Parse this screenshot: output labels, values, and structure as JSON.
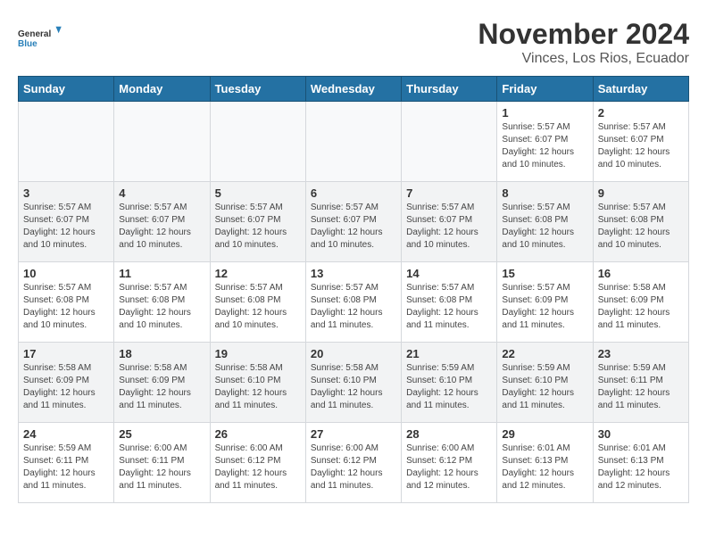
{
  "logo": {
    "general": "General",
    "blue": "Blue"
  },
  "title": "November 2024",
  "subtitle": "Vinces, Los Rios, Ecuador",
  "days_of_week": [
    "Sunday",
    "Monday",
    "Tuesday",
    "Wednesday",
    "Thursday",
    "Friday",
    "Saturday"
  ],
  "weeks": [
    [
      {
        "day": "",
        "info": ""
      },
      {
        "day": "",
        "info": ""
      },
      {
        "day": "",
        "info": ""
      },
      {
        "day": "",
        "info": ""
      },
      {
        "day": "",
        "info": ""
      },
      {
        "day": "1",
        "info": "Sunrise: 5:57 AM\nSunset: 6:07 PM\nDaylight: 12 hours and 10 minutes."
      },
      {
        "day": "2",
        "info": "Sunrise: 5:57 AM\nSunset: 6:07 PM\nDaylight: 12 hours and 10 minutes."
      }
    ],
    [
      {
        "day": "3",
        "info": "Sunrise: 5:57 AM\nSunset: 6:07 PM\nDaylight: 12 hours and 10 minutes."
      },
      {
        "day": "4",
        "info": "Sunrise: 5:57 AM\nSunset: 6:07 PM\nDaylight: 12 hours and 10 minutes."
      },
      {
        "day": "5",
        "info": "Sunrise: 5:57 AM\nSunset: 6:07 PM\nDaylight: 12 hours and 10 minutes."
      },
      {
        "day": "6",
        "info": "Sunrise: 5:57 AM\nSunset: 6:07 PM\nDaylight: 12 hours and 10 minutes."
      },
      {
        "day": "7",
        "info": "Sunrise: 5:57 AM\nSunset: 6:07 PM\nDaylight: 12 hours and 10 minutes."
      },
      {
        "day": "8",
        "info": "Sunrise: 5:57 AM\nSunset: 6:08 PM\nDaylight: 12 hours and 10 minutes."
      },
      {
        "day": "9",
        "info": "Sunrise: 5:57 AM\nSunset: 6:08 PM\nDaylight: 12 hours and 10 minutes."
      }
    ],
    [
      {
        "day": "10",
        "info": "Sunrise: 5:57 AM\nSunset: 6:08 PM\nDaylight: 12 hours and 10 minutes."
      },
      {
        "day": "11",
        "info": "Sunrise: 5:57 AM\nSunset: 6:08 PM\nDaylight: 12 hours and 10 minutes."
      },
      {
        "day": "12",
        "info": "Sunrise: 5:57 AM\nSunset: 6:08 PM\nDaylight: 12 hours and 10 minutes."
      },
      {
        "day": "13",
        "info": "Sunrise: 5:57 AM\nSunset: 6:08 PM\nDaylight: 12 hours and 11 minutes."
      },
      {
        "day": "14",
        "info": "Sunrise: 5:57 AM\nSunset: 6:08 PM\nDaylight: 12 hours and 11 minutes."
      },
      {
        "day": "15",
        "info": "Sunrise: 5:57 AM\nSunset: 6:09 PM\nDaylight: 12 hours and 11 minutes."
      },
      {
        "day": "16",
        "info": "Sunrise: 5:58 AM\nSunset: 6:09 PM\nDaylight: 12 hours and 11 minutes."
      }
    ],
    [
      {
        "day": "17",
        "info": "Sunrise: 5:58 AM\nSunset: 6:09 PM\nDaylight: 12 hours and 11 minutes."
      },
      {
        "day": "18",
        "info": "Sunrise: 5:58 AM\nSunset: 6:09 PM\nDaylight: 12 hours and 11 minutes."
      },
      {
        "day": "19",
        "info": "Sunrise: 5:58 AM\nSunset: 6:10 PM\nDaylight: 12 hours and 11 minutes."
      },
      {
        "day": "20",
        "info": "Sunrise: 5:58 AM\nSunset: 6:10 PM\nDaylight: 12 hours and 11 minutes."
      },
      {
        "day": "21",
        "info": "Sunrise: 5:59 AM\nSunset: 6:10 PM\nDaylight: 12 hours and 11 minutes."
      },
      {
        "day": "22",
        "info": "Sunrise: 5:59 AM\nSunset: 6:10 PM\nDaylight: 12 hours and 11 minutes."
      },
      {
        "day": "23",
        "info": "Sunrise: 5:59 AM\nSunset: 6:11 PM\nDaylight: 12 hours and 11 minutes."
      }
    ],
    [
      {
        "day": "24",
        "info": "Sunrise: 5:59 AM\nSunset: 6:11 PM\nDaylight: 12 hours and 11 minutes."
      },
      {
        "day": "25",
        "info": "Sunrise: 6:00 AM\nSunset: 6:11 PM\nDaylight: 12 hours and 11 minutes."
      },
      {
        "day": "26",
        "info": "Sunrise: 6:00 AM\nSunset: 6:12 PM\nDaylight: 12 hours and 11 minutes."
      },
      {
        "day": "27",
        "info": "Sunrise: 6:00 AM\nSunset: 6:12 PM\nDaylight: 12 hours and 11 minutes."
      },
      {
        "day": "28",
        "info": "Sunrise: 6:00 AM\nSunset: 6:12 PM\nDaylight: 12 hours and 12 minutes."
      },
      {
        "day": "29",
        "info": "Sunrise: 6:01 AM\nSunset: 6:13 PM\nDaylight: 12 hours and 12 minutes."
      },
      {
        "day": "30",
        "info": "Sunrise: 6:01 AM\nSunset: 6:13 PM\nDaylight: 12 hours and 12 minutes."
      }
    ]
  ]
}
